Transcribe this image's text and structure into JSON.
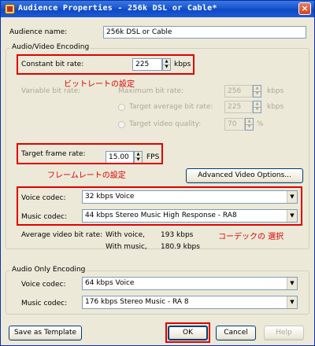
{
  "window": {
    "title": "Audience Properties - 256k DSL or Cable*",
    "close_symbol": "×"
  },
  "audience_name": {
    "label": "Audience name:",
    "value": "256k DSL or Cable"
  },
  "av_group": {
    "title": "Audio/Video Encoding",
    "constant_bitrate": {
      "label": "Constant bit rate:",
      "value": "225",
      "unit": "kbps"
    },
    "variable_bitrate": {
      "label": "Variable bit rate:",
      "max_label": "Maximum bit rate:",
      "max_value": "256",
      "max_unit": "kbps",
      "target_avg_label": "Target average bit rate:",
      "target_avg_value": "225",
      "target_avg_unit": "kbps",
      "target_quality_label": "Target video quality:",
      "target_quality_value": "70",
      "target_quality_unit": "%"
    },
    "frame_rate": {
      "label": "Target frame rate:",
      "value": "15.00",
      "unit": "FPS"
    },
    "advanced_button": "Advanced Video Options...",
    "voice_codec": {
      "label": "Voice codec:",
      "value": "32 kbps Voice"
    },
    "music_codec": {
      "label": "Music codec:",
      "value": "44 kbps Stereo Music High Response - RA8"
    },
    "avg_video": {
      "label": "Average video bit rate:",
      "with_voice_label": "With voice,",
      "with_voice_value": "193 kbps",
      "with_music_label": "With music,",
      "with_music_value": "180.9 kbps"
    }
  },
  "audio_only_group": {
    "title": "Audio Only Encoding",
    "voice_codec": {
      "label": "Voice codec:",
      "value": "64 kbps Voice"
    },
    "music_codec": {
      "label": "Music codec:",
      "value": "176 kbps Stereo Music - RA 8"
    }
  },
  "buttons": {
    "save_template": "Save as Template",
    "ok": "OK",
    "cancel": "Cancel",
    "help": "Help"
  },
  "annotations": {
    "bitrate_note": "ビットレートの設定",
    "framerate_note": "フレームレートの設定",
    "codec_note": "コーデックの 選択"
  },
  "colors": {
    "titlebar": "#0f49c4",
    "annotation": "#e00000",
    "dialog_bg": "#ece9d8"
  }
}
